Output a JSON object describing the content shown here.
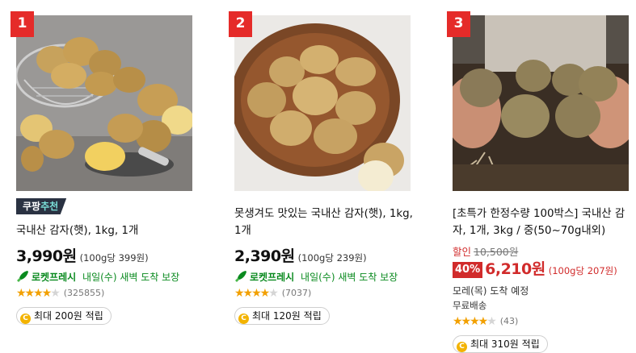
{
  "products": [
    {
      "rank": "1",
      "badge": {
        "brand": "쿠팡",
        "tag": "추천"
      },
      "title": "국내산 감자(햇), 1kg, 1개",
      "price": "3,990원",
      "unit_price": "(100g당 399원)",
      "rocket_label": "로켓프레시",
      "rocket_delivery": "내일(수) 새벽 도착 보장",
      "rating": 4.5,
      "review_count": "(325855)",
      "reward": "최대 200원 적립"
    },
    {
      "rank": "2",
      "title": "못생겨도 맛있는 국내산 감자(햇), 1kg, 1개",
      "price": "2,390원",
      "unit_price": "(100g당 239원)",
      "rocket_label": "로켓프레시",
      "rocket_delivery": "내일(수) 새벽 도착 보장",
      "rating": 4.5,
      "review_count": "(7037)",
      "reward": "최대 120원 적립"
    },
    {
      "rank": "3",
      "title": "[초특가 한정수량 100박스] 국내산 감자, 1개, 3kg / 중(50~70g내외)",
      "discount_label": "할인",
      "original_price": "10,500원",
      "discount_rate": "40%",
      "price": "6,210원",
      "unit_price": "(100g당 207원)",
      "delivery": "모레(목) 도착 예정",
      "shipping": "무료배송",
      "rating": 4.5,
      "review_count": "(43)",
      "reward": "최대 310원 적립"
    }
  ],
  "icons": {
    "coin": "C",
    "rocket": "rocket-icon",
    "star": "★"
  }
}
